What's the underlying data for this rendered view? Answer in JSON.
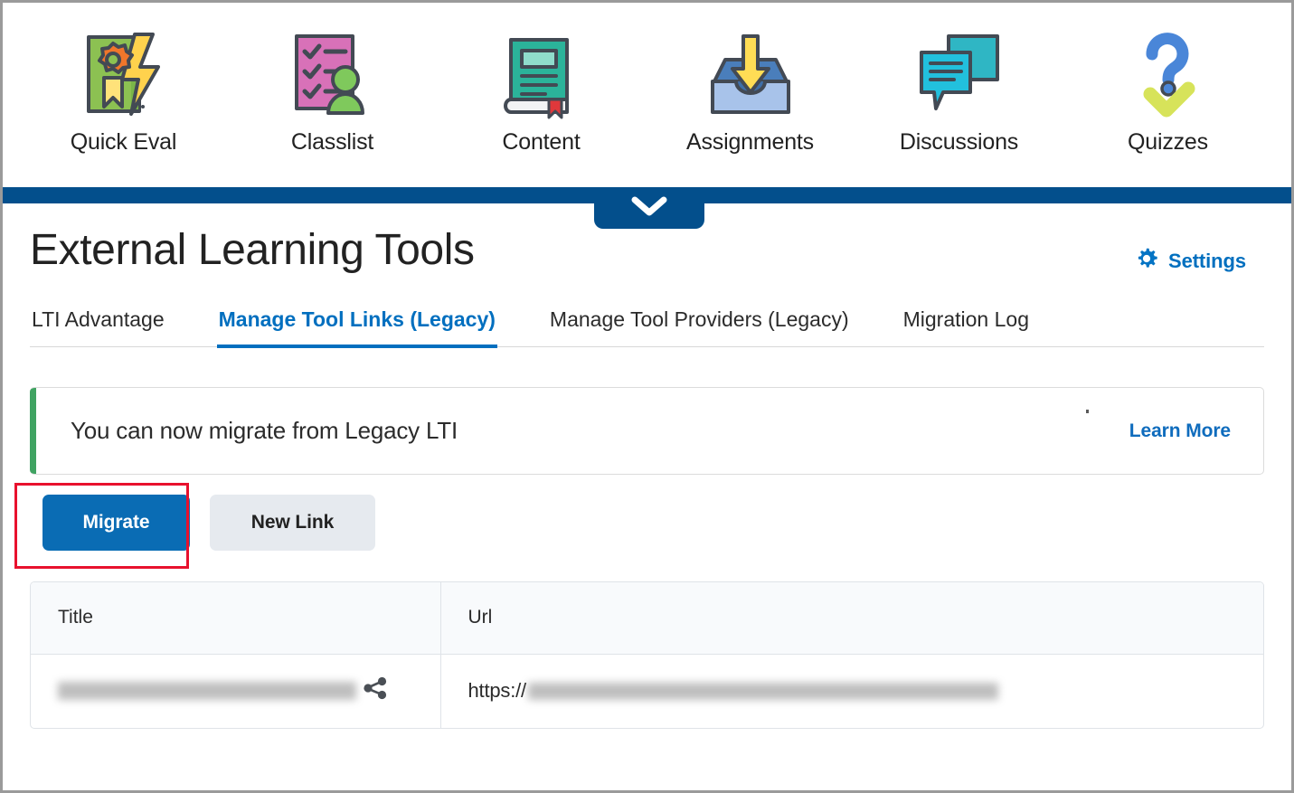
{
  "course_nav": {
    "items": [
      {
        "label": "Quick Eval",
        "icon": "quick-eval-icon"
      },
      {
        "label": "Classlist",
        "icon": "classlist-icon"
      },
      {
        "label": "Content",
        "icon": "content-icon"
      },
      {
        "label": "Assignments",
        "icon": "assignments-icon"
      },
      {
        "label": "Discussions",
        "icon": "discussions-icon"
      },
      {
        "label": "Quizzes",
        "icon": "quizzes-icon"
      }
    ],
    "collapse_icon": "chevron-down-icon",
    "bar_color": "#034f8c"
  },
  "header": {
    "title": "External Learning Tools",
    "settings_label": "Settings",
    "settings_icon": "gear-icon",
    "link_color": "#006fbf"
  },
  "tabs": [
    {
      "label": "LTI Advantage",
      "active": false
    },
    {
      "label": "Manage Tool Links (Legacy)",
      "active": true
    },
    {
      "label": "Manage Tool Providers (Legacy)",
      "active": false
    },
    {
      "label": "Migration Log",
      "active": false
    }
  ],
  "banner": {
    "message": "You can now migrate from Legacy LTI",
    "link_label": "Learn More",
    "accent_color": "#40a362"
  },
  "actions": {
    "migrate_label": "Migrate",
    "new_link_label": "New Link",
    "highlight_color": "#e8112d",
    "primary_color": "#0a6cb4",
    "secondary_color": "#e6eaef"
  },
  "table": {
    "columns": [
      "Title",
      "Url"
    ],
    "rows": [
      {
        "title": "",
        "title_redacted": true,
        "title_icon": "share-icon",
        "url_scheme": "https://",
        "url_rest": "",
        "url_redacted": true
      }
    ]
  }
}
